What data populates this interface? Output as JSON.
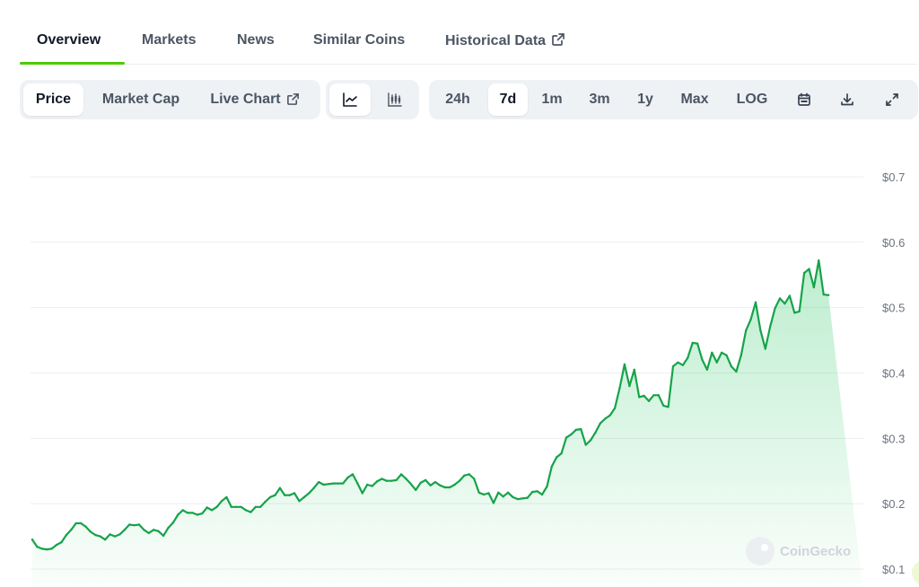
{
  "tabs": [
    {
      "label": "Overview",
      "active": true
    },
    {
      "label": "Markets"
    },
    {
      "label": "News"
    },
    {
      "label": "Similar Coins"
    },
    {
      "label": "Historical Data",
      "icon": "external-link-icon"
    }
  ],
  "toolbar": {
    "data_type": [
      {
        "label": "Price",
        "active": true
      },
      {
        "label": "Market Cap"
      },
      {
        "label": "Live Chart",
        "icon": "external-link-icon"
      }
    ],
    "chart_style": [
      {
        "icon": "line-chart-icon",
        "active": true
      },
      {
        "icon": "candlestick-icon"
      }
    ],
    "ranges": [
      {
        "label": "24h"
      },
      {
        "label": "7d",
        "active": true
      },
      {
        "label": "1m"
      },
      {
        "label": "3m"
      },
      {
        "label": "1y"
      },
      {
        "label": "Max"
      },
      {
        "label": "LOG"
      }
    ],
    "actions": [
      "calendar-icon",
      "download-icon",
      "expand-icon"
    ]
  },
  "watermark": "CoinGecko",
  "colors": {
    "accent": "#4bcc00",
    "line": "#16a34a",
    "fill": "#22c55e",
    "grid": "#eceef2",
    "toolbar_bg": "#eff2f5"
  },
  "chart_data": {
    "type": "area",
    "title": "",
    "xlabel": "",
    "ylabel": "",
    "ylim": [
      0.1,
      0.7
    ],
    "yticks": [
      0.1,
      0.2,
      0.3,
      0.4,
      0.5,
      0.6,
      0.7
    ],
    "ytick_labels": [
      "$0.1",
      "$0.2",
      "$0.3",
      "$0.4",
      "$0.5",
      "$0.6",
      "$0.7"
    ],
    "y_axis_position": "right",
    "grid": true,
    "legend": "none",
    "x": [
      0,
      1,
      2,
      3,
      4,
      5,
      6,
      7,
      8,
      9,
      10,
      11,
      12,
      13,
      14,
      15,
      16,
      17,
      18,
      19,
      20,
      21,
      22,
      23,
      24,
      25,
      26,
      27,
      28,
      29,
      30,
      31,
      32,
      33,
      34,
      35,
      36,
      37,
      38,
      39,
      40,
      41,
      42,
      43,
      44,
      45,
      46,
      47,
      48,
      49,
      50,
      51,
      52,
      53,
      54,
      55,
      56,
      57,
      58,
      59,
      60,
      61,
      62,
      63,
      64,
      65,
      66,
      67,
      68,
      69,
      70,
      71,
      72,
      73,
      74,
      75,
      76,
      77,
      78,
      79,
      80,
      81,
      82,
      83,
      84,
      85,
      86,
      87,
      88,
      89,
      90,
      91,
      92,
      93,
      94,
      95,
      96,
      97,
      98,
      99,
      100,
      101,
      102,
      103,
      104,
      105,
      106,
      107,
      108,
      109,
      110,
      111,
      112,
      113,
      114,
      115,
      116,
      117,
      118,
      119,
      120,
      121,
      122,
      123,
      124,
      125,
      126,
      127,
      128,
      129,
      130,
      131,
      132,
      133,
      134,
      135,
      136,
      137,
      138,
      139,
      140,
      141,
      142,
      143,
      144,
      145,
      146,
      147,
      148,
      149,
      150,
      151,
      152,
      153,
      154,
      155,
      156,
      157,
      158,
      159,
      160,
      161,
      162,
      163,
      164,
      165,
      166,
      167,
      168,
      169,
      170,
      171
    ],
    "series": [
      {
        "values": [
          0.145,
          0.134,
          0.131,
          0.13,
          0.131,
          0.137,
          0.141,
          0.152,
          0.16,
          0.17,
          0.17,
          0.165,
          0.157,
          0.152,
          0.15,
          0.145,
          0.153,
          0.15,
          0.153,
          0.16,
          0.168,
          0.167,
          0.168,
          0.16,
          0.155,
          0.16,
          0.158,
          0.151,
          0.163,
          0.171,
          0.183,
          0.19,
          0.186,
          0.186,
          0.183,
          0.185,
          0.194,
          0.19,
          0.195,
          0.204,
          0.21,
          0.195,
          0.195,
          0.195,
          0.19,
          0.187,
          0.195,
          0.195,
          0.203,
          0.21,
          0.213,
          0.224,
          0.213,
          0.213,
          0.216,
          0.204,
          0.21,
          0.216,
          0.224,
          0.233,
          0.229,
          0.23,
          0.231,
          0.231,
          0.231,
          0.24,
          0.245,
          0.231,
          0.216,
          0.229,
          0.227,
          0.234,
          0.238,
          0.235,
          0.235,
          0.236,
          0.245,
          0.238,
          0.23,
          0.221,
          0.232,
          0.236,
          0.228,
          0.233,
          0.228,
          0.225,
          0.225,
          0.229,
          0.235,
          0.243,
          0.245,
          0.238,
          0.217,
          0.214,
          0.216,
          0.201,
          0.217,
          0.211,
          0.217,
          0.21,
          0.207,
          0.208,
          0.209,
          0.218,
          0.219,
          0.214,
          0.226,
          0.257,
          0.271,
          0.277,
          0.301,
          0.306,
          0.313,
          0.314,
          0.29,
          0.297,
          0.309,
          0.323,
          0.33,
          0.335,
          0.346,
          0.377,
          0.413,
          0.38,
          0.405,
          0.363,
          0.365,
          0.357,
          0.366,
          0.366,
          0.35,
          0.348,
          0.41,
          0.416,
          0.412,
          0.423,
          0.446,
          0.445,
          0.42,
          0.405,
          0.431,
          0.416,
          0.431,
          0.427,
          0.41,
          0.402,
          0.427,
          0.465,
          0.482,
          0.508,
          0.465,
          0.437,
          0.471,
          0.499,
          0.514,
          0.506,
          0.518,
          0.492,
          0.494,
          0.553,
          0.559,
          0.531,
          0.572,
          0.52,
          0.519
        ]
      }
    ]
  }
}
